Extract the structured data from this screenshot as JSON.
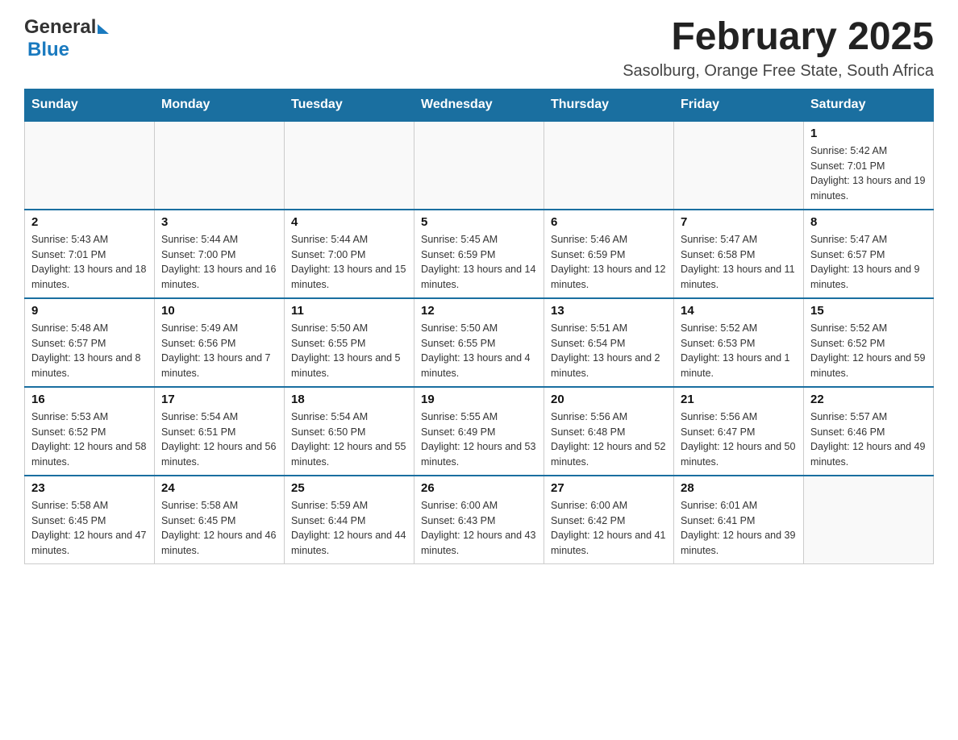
{
  "header": {
    "logo_general": "General",
    "logo_blue": "Blue",
    "month_title": "February 2025",
    "location": "Sasolburg, Orange Free State, South Africa"
  },
  "days_of_week": [
    "Sunday",
    "Monday",
    "Tuesday",
    "Wednesday",
    "Thursday",
    "Friday",
    "Saturday"
  ],
  "weeks": [
    {
      "days": [
        {
          "date": "",
          "info": ""
        },
        {
          "date": "",
          "info": ""
        },
        {
          "date": "",
          "info": ""
        },
        {
          "date": "",
          "info": ""
        },
        {
          "date": "",
          "info": ""
        },
        {
          "date": "",
          "info": ""
        },
        {
          "date": "1",
          "info": "Sunrise: 5:42 AM\nSunset: 7:01 PM\nDaylight: 13 hours and 19 minutes."
        }
      ]
    },
    {
      "days": [
        {
          "date": "2",
          "info": "Sunrise: 5:43 AM\nSunset: 7:01 PM\nDaylight: 13 hours and 18 minutes."
        },
        {
          "date": "3",
          "info": "Sunrise: 5:44 AM\nSunset: 7:00 PM\nDaylight: 13 hours and 16 minutes."
        },
        {
          "date": "4",
          "info": "Sunrise: 5:44 AM\nSunset: 7:00 PM\nDaylight: 13 hours and 15 minutes."
        },
        {
          "date": "5",
          "info": "Sunrise: 5:45 AM\nSunset: 6:59 PM\nDaylight: 13 hours and 14 minutes."
        },
        {
          "date": "6",
          "info": "Sunrise: 5:46 AM\nSunset: 6:59 PM\nDaylight: 13 hours and 12 minutes."
        },
        {
          "date": "7",
          "info": "Sunrise: 5:47 AM\nSunset: 6:58 PM\nDaylight: 13 hours and 11 minutes."
        },
        {
          "date": "8",
          "info": "Sunrise: 5:47 AM\nSunset: 6:57 PM\nDaylight: 13 hours and 9 minutes."
        }
      ]
    },
    {
      "days": [
        {
          "date": "9",
          "info": "Sunrise: 5:48 AM\nSunset: 6:57 PM\nDaylight: 13 hours and 8 minutes."
        },
        {
          "date": "10",
          "info": "Sunrise: 5:49 AM\nSunset: 6:56 PM\nDaylight: 13 hours and 7 minutes."
        },
        {
          "date": "11",
          "info": "Sunrise: 5:50 AM\nSunset: 6:55 PM\nDaylight: 13 hours and 5 minutes."
        },
        {
          "date": "12",
          "info": "Sunrise: 5:50 AM\nSunset: 6:55 PM\nDaylight: 13 hours and 4 minutes."
        },
        {
          "date": "13",
          "info": "Sunrise: 5:51 AM\nSunset: 6:54 PM\nDaylight: 13 hours and 2 minutes."
        },
        {
          "date": "14",
          "info": "Sunrise: 5:52 AM\nSunset: 6:53 PM\nDaylight: 13 hours and 1 minute."
        },
        {
          "date": "15",
          "info": "Sunrise: 5:52 AM\nSunset: 6:52 PM\nDaylight: 12 hours and 59 minutes."
        }
      ]
    },
    {
      "days": [
        {
          "date": "16",
          "info": "Sunrise: 5:53 AM\nSunset: 6:52 PM\nDaylight: 12 hours and 58 minutes."
        },
        {
          "date": "17",
          "info": "Sunrise: 5:54 AM\nSunset: 6:51 PM\nDaylight: 12 hours and 56 minutes."
        },
        {
          "date": "18",
          "info": "Sunrise: 5:54 AM\nSunset: 6:50 PM\nDaylight: 12 hours and 55 minutes."
        },
        {
          "date": "19",
          "info": "Sunrise: 5:55 AM\nSunset: 6:49 PM\nDaylight: 12 hours and 53 minutes."
        },
        {
          "date": "20",
          "info": "Sunrise: 5:56 AM\nSunset: 6:48 PM\nDaylight: 12 hours and 52 minutes."
        },
        {
          "date": "21",
          "info": "Sunrise: 5:56 AM\nSunset: 6:47 PM\nDaylight: 12 hours and 50 minutes."
        },
        {
          "date": "22",
          "info": "Sunrise: 5:57 AM\nSunset: 6:46 PM\nDaylight: 12 hours and 49 minutes."
        }
      ]
    },
    {
      "days": [
        {
          "date": "23",
          "info": "Sunrise: 5:58 AM\nSunset: 6:45 PM\nDaylight: 12 hours and 47 minutes."
        },
        {
          "date": "24",
          "info": "Sunrise: 5:58 AM\nSunset: 6:45 PM\nDaylight: 12 hours and 46 minutes."
        },
        {
          "date": "25",
          "info": "Sunrise: 5:59 AM\nSunset: 6:44 PM\nDaylight: 12 hours and 44 minutes."
        },
        {
          "date": "26",
          "info": "Sunrise: 6:00 AM\nSunset: 6:43 PM\nDaylight: 12 hours and 43 minutes."
        },
        {
          "date": "27",
          "info": "Sunrise: 6:00 AM\nSunset: 6:42 PM\nDaylight: 12 hours and 41 minutes."
        },
        {
          "date": "28",
          "info": "Sunrise: 6:01 AM\nSunset: 6:41 PM\nDaylight: 12 hours and 39 minutes."
        },
        {
          "date": "",
          "info": ""
        }
      ]
    }
  ]
}
